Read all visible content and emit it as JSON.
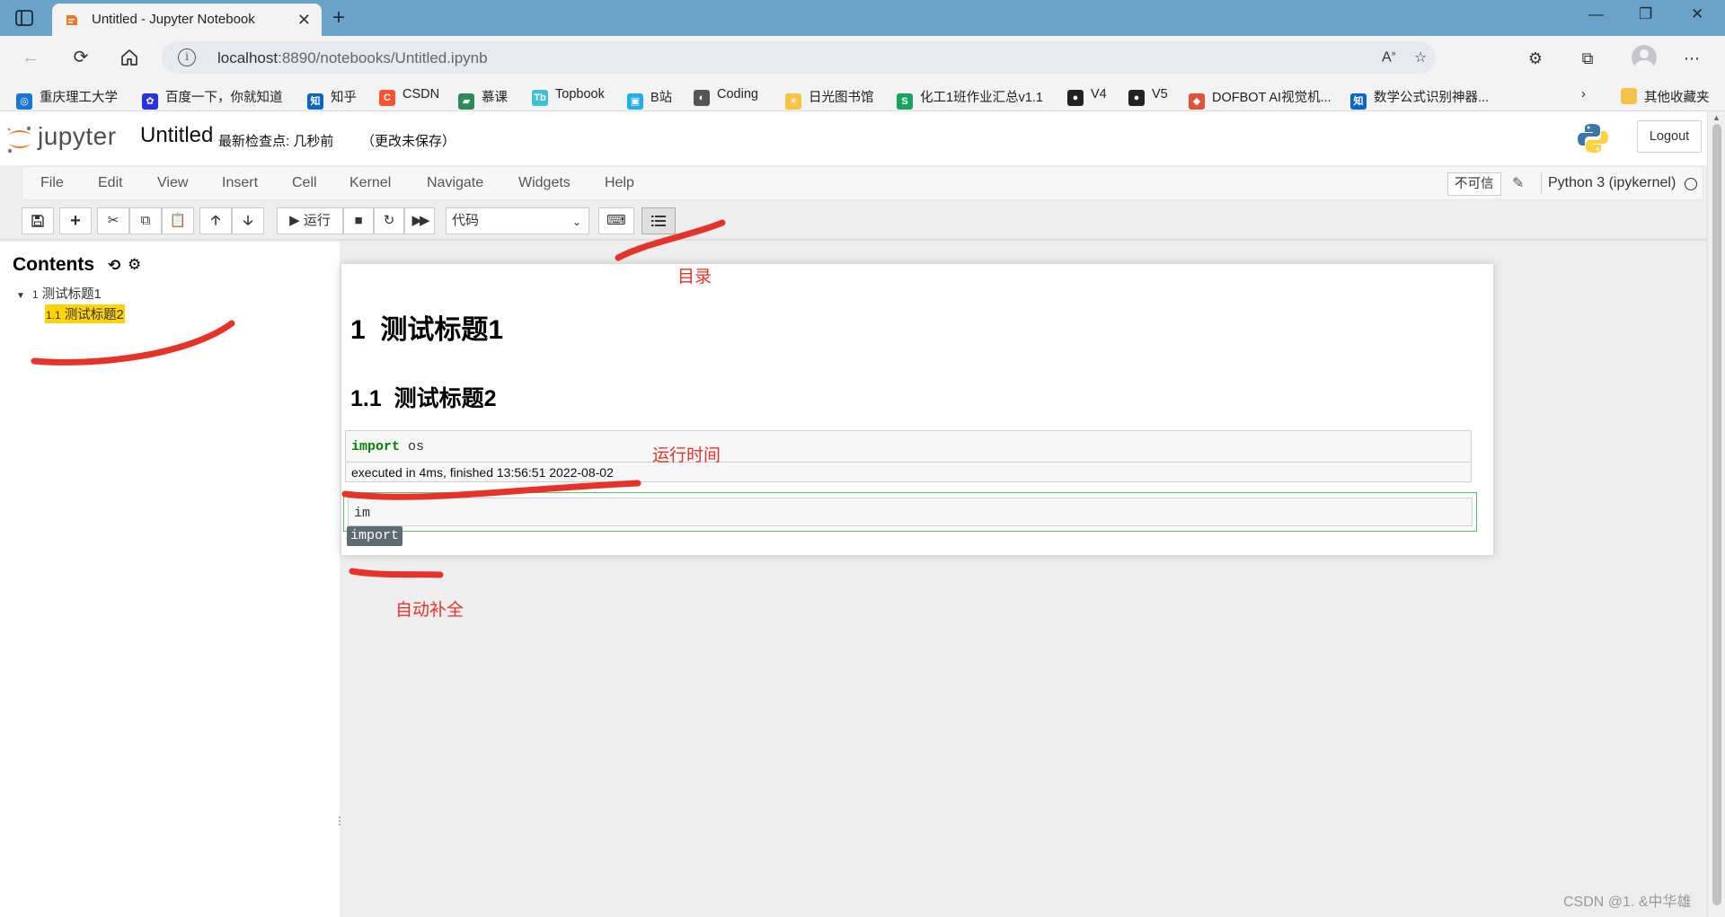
{
  "browser": {
    "tab_title": "Untitled - Jupyter Notebook",
    "url_host": "localhost",
    "url_rest": ":8890/notebooks/Untitled.ipynb",
    "bookmarks": [
      {
        "label": "重庆理工大学",
        "icon": "cqut-logo-icon",
        "color": "#1976d2"
      },
      {
        "label": "百度一下，你就知道",
        "icon": "baidu-paw-icon",
        "color": "#2932e1"
      },
      {
        "label": "知乎",
        "icon": "zhihu-icon",
        "color": "#0a66c2"
      },
      {
        "label": "CSDN",
        "icon": "csdn-icon",
        "color": "#fc5531"
      },
      {
        "label": "慕课",
        "icon": "mooc-icon",
        "color": "#2e8b57"
      },
      {
        "label": "Topbook",
        "icon": "topbook-icon",
        "color": "#3ec1d3"
      },
      {
        "label": "B站",
        "icon": "bilibili-icon",
        "color": "#23ade5"
      },
      {
        "label": "Coding",
        "icon": "coding-icon",
        "color": "#555555"
      },
      {
        "label": "日光图书馆",
        "icon": "sun-icon",
        "color": "#f6c342"
      },
      {
        "label": "化工1班作业汇总v1.1",
        "icon": "sheet-icon",
        "color": "#19a15f"
      },
      {
        "label": "V4",
        "icon": "github-icon",
        "color": "#222222"
      },
      {
        "label": "V5",
        "icon": "github-icon",
        "color": "#222222"
      },
      {
        "label": "DOFBOT AI视觉机...",
        "icon": "dofbot-icon",
        "color": "#e0533b"
      },
      {
        "label": "数学公式识别神器...",
        "icon": "zhihu-icon",
        "color": "#0a66c2"
      }
    ],
    "other_bookmarks": "其他收藏夹"
  },
  "jupyter": {
    "logo_text": "jupyter",
    "notebook_name": "Untitled",
    "checkpoint": "最新检查点: 几秒前",
    "autosave": "（更改未保存）",
    "logout": "Logout",
    "menu": [
      "File",
      "Edit",
      "View",
      "Insert",
      "Cell",
      "Kernel",
      "Navigate",
      "Widgets",
      "Help"
    ],
    "trusted": "不可信",
    "kernel": "Python 3 (ipykernel)",
    "run_label": "运行",
    "cell_type": "代码"
  },
  "toc": {
    "title": "Contents",
    "items": [
      {
        "num": "1",
        "label": "测试标题1"
      },
      {
        "num": "1.1",
        "label": "测试标题2"
      }
    ]
  },
  "notebook": {
    "h1_num": "1",
    "h1_text": "测试标题1",
    "h2_num": "1.1",
    "h2_text": "测试标题2",
    "code_keyword": "import",
    "code_rest": " os",
    "exec_time": "executed in 4ms, finished 13:56:51 2022-08-02",
    "edit_text": "im",
    "autocomplete": "import"
  },
  "annotations": {
    "toc_note": "目录",
    "runtime_note": "运行时间",
    "autocomplete_note": "自动补全",
    "color": "#e5332a"
  },
  "watermark": "CSDN @1. &中华雄"
}
